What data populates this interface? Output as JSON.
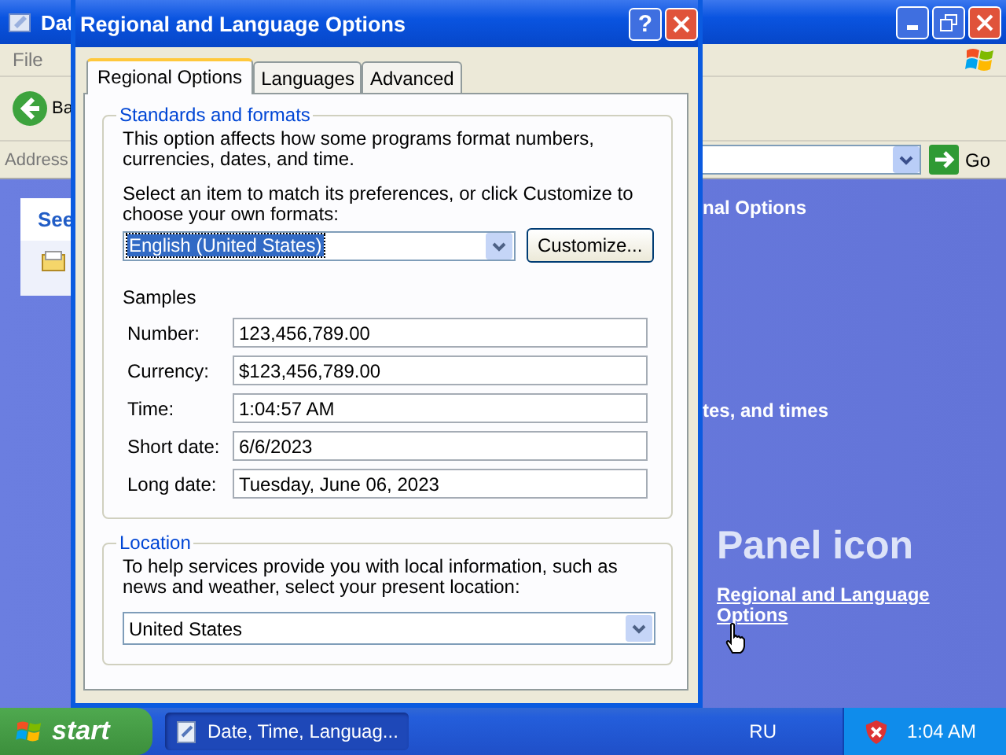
{
  "explorer": {
    "title": "Dat",
    "menu": [
      "File"
    ],
    "back_label": "Ba",
    "address_label": "Address",
    "go_label": "Go",
    "task_pane_title": "See",
    "heading": "nal Options",
    "subheading": "tes, and times",
    "panel_heading": "Panel icon",
    "link": "Regional and Language Options"
  },
  "dialog": {
    "title": "Regional and Language Options",
    "help": "?",
    "tabs": [
      {
        "label": "Regional Options",
        "selected": true
      },
      {
        "label": "Languages",
        "selected": false
      },
      {
        "label": "Advanced",
        "selected": false
      }
    ],
    "standards": {
      "title": "Standards and formats",
      "description": "This option affects how some programs format numbers, currencies, dates, and time.",
      "prompt": "Select an item to match its preferences, or click Customize to choose your own formats:",
      "locale": {
        "value": "English (United States)",
        "highlighted": true
      },
      "customize": "Customize...",
      "samples_label": "Samples",
      "samples": [
        {
          "label": "Number:",
          "value": "123,456,789.00"
        },
        {
          "label": "Currency:",
          "value": "$123,456,789.00"
        },
        {
          "label": "Time:",
          "value": "1:04:57 AM"
        },
        {
          "label": "Short date:",
          "value": "6/6/2023"
        },
        {
          "label": "Long date:",
          "value": "Tuesday, June 06, 2023"
        }
      ]
    },
    "location": {
      "title": "Location",
      "description": "To help services provide you with local information, such as news and weather, select your present location:",
      "value": "United States"
    }
  },
  "taskbar": {
    "start": "start",
    "tasks": [
      {
        "label": "Date, Time, Languag...",
        "selected": true
      }
    ],
    "language": "RU",
    "clock": "1:04 AM"
  }
}
